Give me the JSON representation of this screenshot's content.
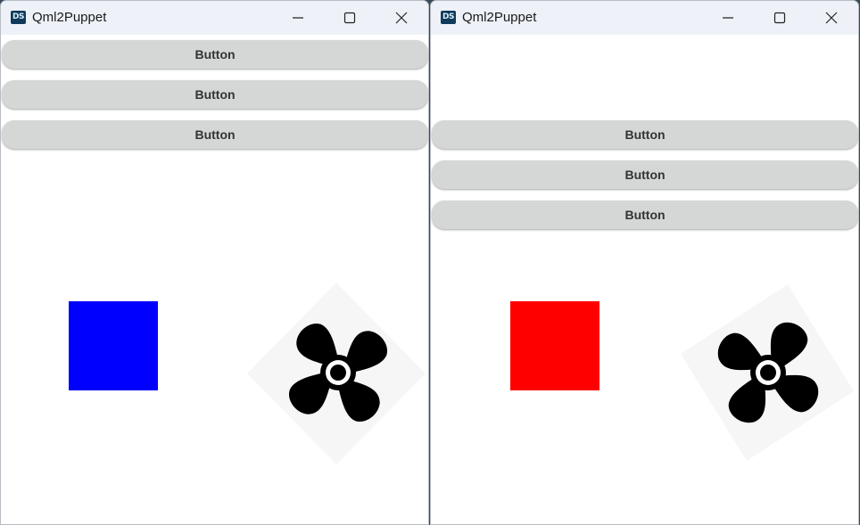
{
  "windows": [
    {
      "title": "Qml2Puppet",
      "icon_text": "DS",
      "buttons": [
        "Button",
        "Button",
        "Button"
      ],
      "square_color": "#0000ff"
    },
    {
      "title": "Qml2Puppet",
      "icon_text": "DS",
      "buttons": [
        "Button",
        "Button",
        "Button"
      ],
      "square_color": "#ff0000"
    }
  ],
  "icons": {
    "app": "designstudio-app-icon",
    "minimize": "minimize-icon",
    "maximize": "maximize-icon",
    "close": "close-icon",
    "fan": "propeller-fan-icon"
  },
  "colors": {
    "titlebar": "#eef2f8",
    "button_bg": "#d5d6d6",
    "button_text": "#333333"
  }
}
